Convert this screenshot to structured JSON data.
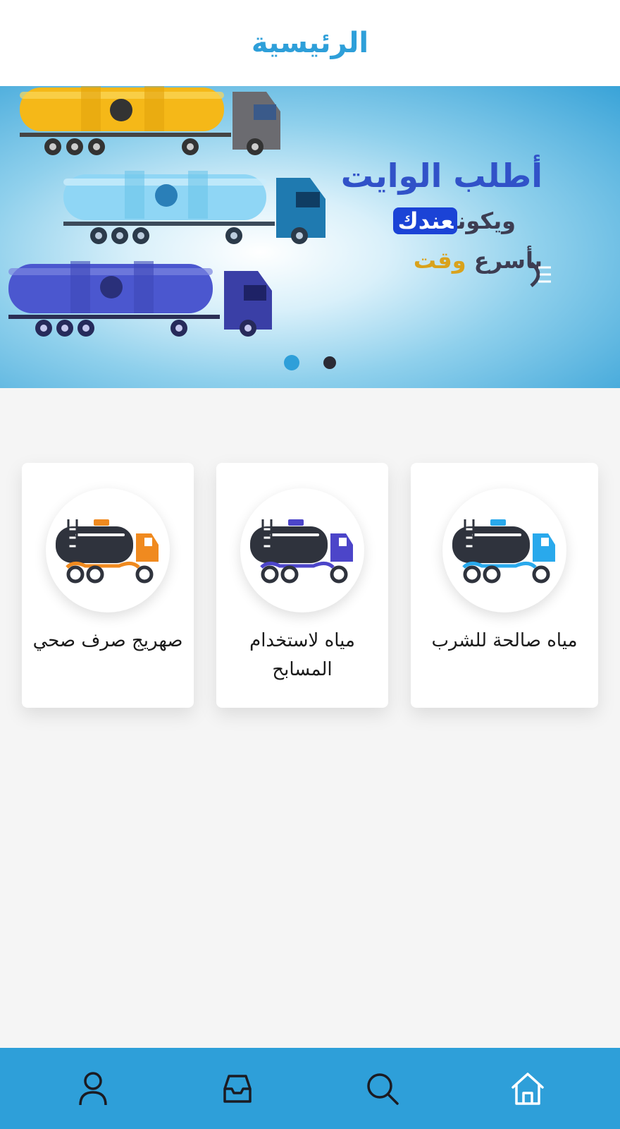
{
  "header": {
    "title": "الرئيسية"
  },
  "banner": {
    "line1": "أطلب الوايت",
    "line2_prefix": "ويكون",
    "line2_highlight": "عندك",
    "line3_prefix": "بأسرع",
    "line3_highlight": "وقت",
    "slides_count": 2,
    "active_slide": 1
  },
  "services": [
    {
      "label": "مياه صالحة للشرب",
      "accent": "#29a9ec"
    },
    {
      "label": "مياه لاستخدام المسابح",
      "accent": "#4c45c9"
    },
    {
      "label": "صهريج صرف صحي",
      "accent": "#f08a1f"
    }
  ],
  "bottom_nav": {
    "items": [
      {
        "name": "home",
        "icon": "home-icon"
      },
      {
        "name": "search",
        "icon": "search-icon"
      },
      {
        "name": "orders",
        "icon": "inbox-icon"
      },
      {
        "name": "profile",
        "icon": "user-icon"
      }
    ]
  },
  "colors": {
    "primary": "#2e9fd9",
    "dark": "#2b2b35"
  }
}
